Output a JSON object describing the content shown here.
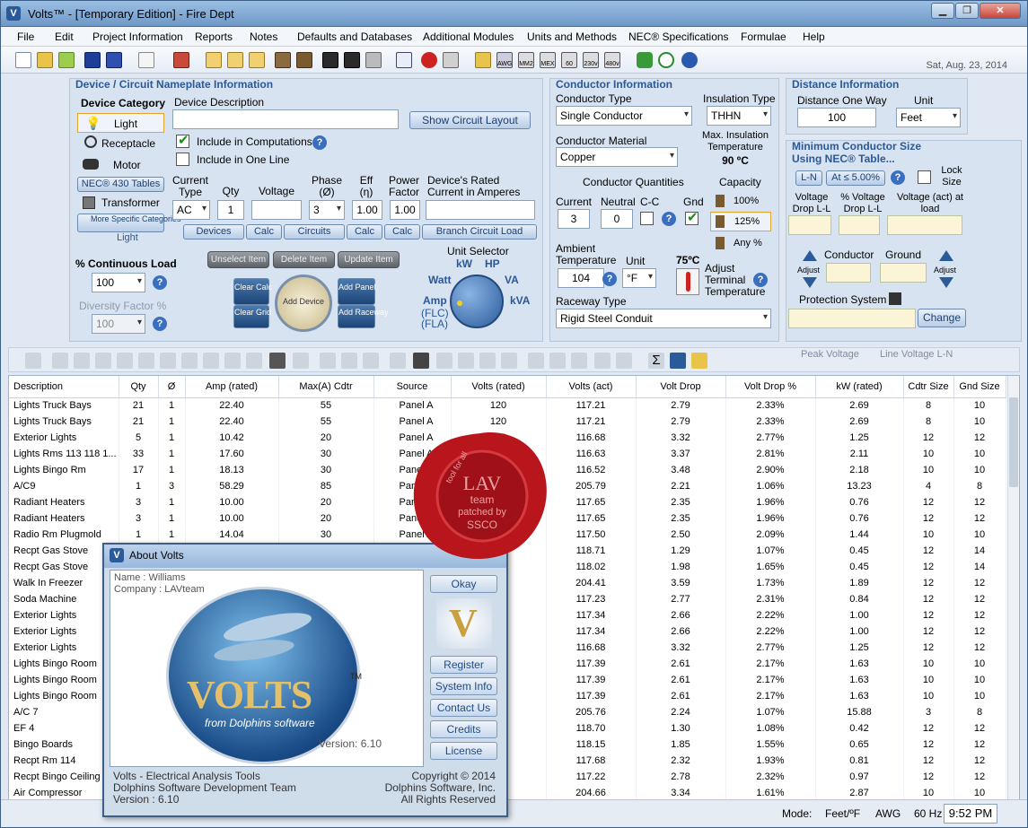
{
  "window": {
    "title": "Volts™ - [Temporary Edition] - Fire Dept"
  },
  "menu": [
    "File",
    "Edit",
    "Project Information",
    "Reports",
    "Notes",
    "Defaults and Databases",
    "Additional Modules",
    "Units and Methods",
    "NEC® Specifications",
    "Formulae",
    "Help"
  ],
  "toolbar": {
    "date": "Sat, Aug. 23, 2014",
    "icon_labels": [
      "AWG",
      "MM2",
      "MEX",
      "60",
      "230v",
      "480v"
    ]
  },
  "device": {
    "title": "Device / Circuit Nameplate Information",
    "category_label": "Device Category",
    "categories": [
      "Light",
      "Receptacle",
      "Motor",
      "NEC® 430 Tables",
      "Transformer",
      "More Specific Categories",
      "Light"
    ],
    "desc_label": "Device Description",
    "desc_value": "",
    "show_layout": "Show Circuit Layout",
    "include_computations": "Include in Computations",
    "include_oneline": "Include in One Line",
    "current_type_label": "Current Type",
    "current_type": "AC",
    "qty_label": "Qty",
    "qty": "1",
    "voltage_label": "Voltage",
    "voltage": "",
    "phase_label": "Phase (Ø)",
    "phase": "3",
    "eff_label": "Eff (η)",
    "eff": "1.00",
    "pf_label": "Power Factor",
    "pf": "1.00",
    "rated_label": "Device's Rated Current in Amperes",
    "rated": "",
    "strip": [
      "Devices",
      "Calc",
      "Circuits",
      "Calc",
      "Calc",
      "Branch Circuit Load"
    ],
    "cont_load_label": "% Continuous Load",
    "cont_load": "100",
    "diversity_label": "Diversity Factor %",
    "diversity": "100",
    "item_buttons": [
      "Unselect Item",
      "Delete Item",
      "Update Item"
    ],
    "clear_calc": "Clear Calc",
    "clear_grid": "Clear Grid",
    "add_device": "Add Device",
    "add_panel": "Add Panel",
    "add_raceway": "Add Raceway",
    "unit_selector": "Unit Selector",
    "units": [
      "kW",
      "HP",
      "Watt",
      "VA",
      "Amp",
      "kVA",
      "(FLC)",
      "(FLA)"
    ]
  },
  "conductor": {
    "title": "Conductor Information",
    "type_label": "Conductor Type",
    "type": "Single Conductor",
    "insul_label": "Insulation Type",
    "insul": "THHN",
    "max_insul_label": "Max. Insulation Temperature",
    "max_insul": "90 ºC",
    "material_label": "Conductor Material",
    "material": "Copper",
    "quantities_label": "Conductor Quantities",
    "current_label": "Current",
    "current": "3",
    "neutral_label": "Neutral",
    "neutral": "0",
    "cc_label": "C-C",
    "gnd_label": "Gnd",
    "capacity_label": "Capacity",
    "cap": [
      "100%",
      "125%",
      "Any %"
    ],
    "ambient_label": "Ambient Temperature",
    "ambient": "104",
    "unit_label": "Unit",
    "unit": "°F",
    "term_temp": "75ºC",
    "adjust_term": "Adjust Terminal Temperature",
    "raceway_label": "Raceway Type",
    "raceway": "Rigid Steel Conduit"
  },
  "distance": {
    "title": "Distance Information",
    "one_way_label": "Distance One Way",
    "one_way": "100",
    "unit_label": "Unit",
    "unit": "Feet"
  },
  "mincond": {
    "title": "Minimum Conductor Size",
    "subtitle": "Using NEC® Table...",
    "ll_btn": "L-N",
    "pct_btn": "At ≤ 5.00%",
    "lock": "Lock Size",
    "vdrop_label": "Voltage Drop L-L",
    "pvdrop_label": "% Voltage Drop L-L",
    "vact_label": "Voltage (act) at load",
    "adjust": "Adjust",
    "conductor_label": "Conductor",
    "ground_label": "Ground",
    "protection_label": "Protection System",
    "change": "Change"
  },
  "bar2": {
    "peak": "Peak Voltage",
    "line": "Line Voltage L-N"
  },
  "table": {
    "headers": [
      "Description",
      "Qty",
      "Ø",
      "Amp (rated)",
      "Max(A) Cdtr",
      "Source",
      "Volts (rated)",
      "Volts (act)",
      "Volt Drop",
      "Volt Drop %",
      "kW (rated)",
      "Cdtr Size",
      "Gnd Size"
    ],
    "rows": [
      [
        "Lights Truck Bays",
        "21",
        "1",
        "22.40",
        "55",
        "Panel A",
        "120",
        "117.21",
        "2.79",
        "2.33%",
        "2.69",
        "8",
        "10"
      ],
      [
        "Lights Truck Bays",
        "21",
        "1",
        "22.40",
        "55",
        "Panel A",
        "120",
        "117.21",
        "2.79",
        "2.33%",
        "2.69",
        "8",
        "10"
      ],
      [
        "Exterior Lights",
        "5",
        "1",
        "10.42",
        "20",
        "Panel A",
        "120",
        "116.68",
        "3.32",
        "2.77%",
        "1.25",
        "12",
        "12"
      ],
      [
        "Lights Rms 113 118 1...",
        "33",
        "1",
        "17.60",
        "30",
        "Panel A",
        "120",
        "116.63",
        "3.37",
        "2.81%",
        "2.11",
        "10",
        "10"
      ],
      [
        "Lights Bingo Rm",
        "17",
        "1",
        "18.13",
        "30",
        "Panel A",
        "120",
        "116.52",
        "3.48",
        "2.90%",
        "2.18",
        "10",
        "10"
      ],
      [
        "A/C9",
        "1",
        "3",
        "58.29",
        "85",
        "Panel A",
        "",
        "205.79",
        "2.21",
        "1.06%",
        "13.23",
        "4",
        "8"
      ],
      [
        "Radiant Heaters",
        "3",
        "1",
        "10.00",
        "20",
        "Panel",
        "",
        "117.65",
        "2.35",
        "1.96%",
        "0.76",
        "12",
        "12"
      ],
      [
        "Radiant Heaters",
        "3",
        "1",
        "10.00",
        "20",
        "Panel",
        "",
        "117.65",
        "2.35",
        "1.96%",
        "0.76",
        "12",
        "12"
      ],
      [
        "Radio Rm Plugmold",
        "1",
        "1",
        "14.04",
        "30",
        "Panel A",
        "",
        "117.50",
        "2.50",
        "2.09%",
        "1.44",
        "10",
        "10"
      ],
      [
        "Recpt Gas Stove",
        "",
        "",
        "",
        "",
        "",
        "",
        "118.71",
        "1.29",
        "1.07%",
        "0.45",
        "12",
        "14"
      ],
      [
        "Recpt Gas Stove",
        "",
        "",
        "",
        "",
        "",
        "",
        "118.02",
        "1.98",
        "1.65%",
        "0.45",
        "12",
        "14"
      ],
      [
        "Walk In Freezer",
        "",
        "",
        "",
        "",
        "",
        "",
        "204.41",
        "3.59",
        "1.73%",
        "1.89",
        "12",
        "12"
      ],
      [
        "Soda Machine",
        "",
        "",
        "",
        "",
        "",
        "",
        "117.23",
        "2.77",
        "2.31%",
        "0.84",
        "12",
        "12"
      ],
      [
        "Exterior Lights",
        "",
        "",
        "",
        "",
        "",
        "",
        "117.34",
        "2.66",
        "2.22%",
        "1.00",
        "12",
        "12"
      ],
      [
        "Exterior Lights",
        "",
        "",
        "",
        "",
        "",
        "",
        "117.34",
        "2.66",
        "2.22%",
        "1.00",
        "12",
        "12"
      ],
      [
        "Exterior Lights",
        "",
        "",
        "",
        "",
        "",
        "",
        "116.68",
        "3.32",
        "2.77%",
        "1.25",
        "12",
        "12"
      ],
      [
        "Lights Bingo Room",
        "",
        "",
        "",
        "",
        "",
        "",
        "117.39",
        "2.61",
        "2.17%",
        "1.63",
        "10",
        "10"
      ],
      [
        "Lights Bingo Room",
        "",
        "",
        "",
        "",
        "",
        "",
        "117.39",
        "2.61",
        "2.17%",
        "1.63",
        "10",
        "10"
      ],
      [
        "Lights Bingo Room",
        "",
        "",
        "",
        "",
        "",
        "",
        "117.39",
        "2.61",
        "2.17%",
        "1.63",
        "10",
        "10"
      ],
      [
        "A/C 7",
        "",
        "",
        "",
        "",
        "",
        "",
        "205.76",
        "2.24",
        "1.07%",
        "15.88",
        "3",
        "8"
      ],
      [
        "EF 4",
        "",
        "",
        "",
        "",
        "",
        "",
        "118.70",
        "1.30",
        "1.08%",
        "0.42",
        "12",
        "12"
      ],
      [
        "Bingo Boards",
        "",
        "",
        "",
        "",
        "",
        "",
        "118.15",
        "1.85",
        "1.55%",
        "0.65",
        "12",
        "12"
      ],
      [
        "Recpt Rm 114",
        "",
        "",
        "",
        "",
        "",
        "",
        "117.68",
        "2.32",
        "1.93%",
        "0.81",
        "12",
        "12"
      ],
      [
        "Recpt Bingo Ceiling",
        "",
        "",
        "",
        "",
        "",
        "",
        "117.22",
        "2.78",
        "2.32%",
        "0.97",
        "12",
        "12"
      ],
      [
        "Air Compressor",
        "",
        "",
        "",
        "",
        "",
        "",
        "204.66",
        "3.34",
        "1.61%",
        "2.87",
        "10",
        "10"
      ]
    ]
  },
  "about": {
    "title": "About Volts",
    "name": "Name :  Williams",
    "company": "Company :  LAVteam",
    "logo": "VOLTS",
    "tm": "TM",
    "from": "from Dolphins software",
    "version": "Version: 6.10",
    "buttons": [
      "Okay",
      "Register",
      "System Info",
      "Contact Us",
      "Credits",
      "License"
    ],
    "footer_left": [
      "Volts - Electrical Analysis Tools",
      "Dolphins Software Development Team",
      "Version : 6.10"
    ],
    "footer_right": [
      "Copyright © 2014",
      "Dolphins Software, Inc.",
      "All Rights Reserved"
    ]
  },
  "seal": {
    "lines": [
      "LAV",
      "team",
      "patched by",
      "SSCO",
      "tool for all"
    ]
  },
  "status": {
    "mode_label": "Mode:",
    "mode": "Feet/ºF",
    "awg": "AWG",
    "hz": "60 Hz",
    "time": "9:52 PM"
  }
}
